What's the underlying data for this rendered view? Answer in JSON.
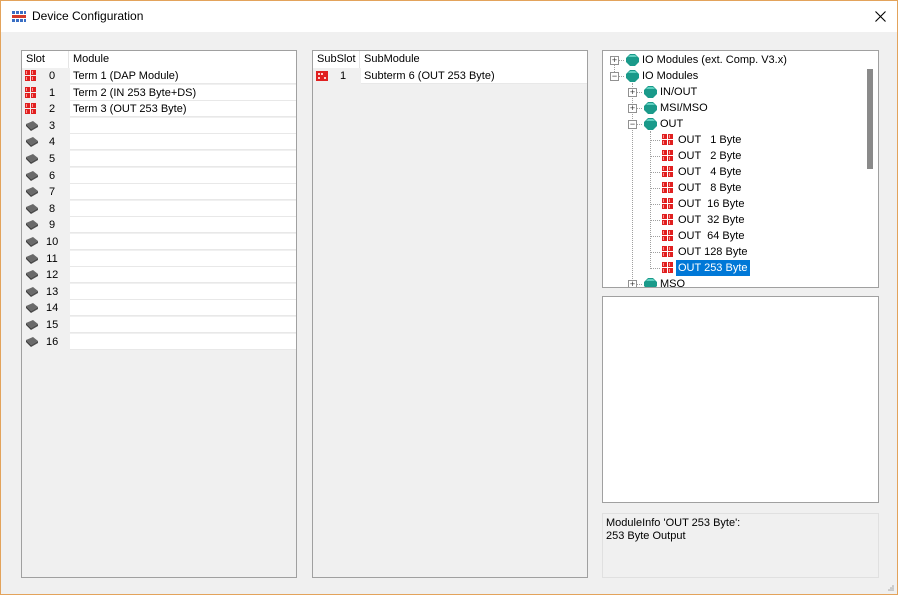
{
  "window": {
    "title": "Device Configuration"
  },
  "slots": {
    "headers": {
      "slot": "Slot",
      "module": "Module"
    },
    "rows": [
      {
        "slot": "0",
        "module": "Term 1 (DAP Module)",
        "icon": "module-red-icon"
      },
      {
        "slot": "1",
        "module": "Term 2 (IN 253 Byte+DS)",
        "icon": "module-red-icon"
      },
      {
        "slot": "2",
        "module": "Term 3 (OUT 253 Byte)",
        "icon": "module-red-icon"
      },
      {
        "slot": "3",
        "module": "",
        "icon": "empty-slot-icon"
      },
      {
        "slot": "4",
        "module": "",
        "icon": "empty-slot-icon"
      },
      {
        "slot": "5",
        "module": "",
        "icon": "empty-slot-icon"
      },
      {
        "slot": "6",
        "module": "",
        "icon": "empty-slot-icon"
      },
      {
        "slot": "7",
        "module": "",
        "icon": "empty-slot-icon"
      },
      {
        "slot": "8",
        "module": "",
        "icon": "empty-slot-icon"
      },
      {
        "slot": "9",
        "module": "",
        "icon": "empty-slot-icon"
      },
      {
        "slot": "10",
        "module": "",
        "icon": "empty-slot-icon"
      },
      {
        "slot": "11",
        "module": "",
        "icon": "empty-slot-icon"
      },
      {
        "slot": "12",
        "module": "",
        "icon": "empty-slot-icon"
      },
      {
        "slot": "13",
        "module": "",
        "icon": "empty-slot-icon"
      },
      {
        "slot": "14",
        "module": "",
        "icon": "empty-slot-icon"
      },
      {
        "slot": "15",
        "module": "",
        "icon": "empty-slot-icon"
      },
      {
        "slot": "16",
        "module": "",
        "icon": "empty-slot-icon"
      }
    ]
  },
  "subslots": {
    "headers": {
      "subslot": "SubSlot",
      "submodule": "SubModule"
    },
    "rows": [
      {
        "subslot": "1",
        "submodule": "Subterm 6 (OUT 253 Byte)",
        "icon": "submodule-red-icon"
      }
    ]
  },
  "catalog": {
    "items": [
      {
        "label": "IO Modules (ext. Comp. V3.x)",
        "expander": "+",
        "icon": "module-group-icon"
      },
      {
        "label": "IO Modules",
        "expander": "−",
        "icon": "module-group-icon"
      },
      {
        "label": "IN/OUT",
        "expander": "+",
        "icon": "module-group-icon"
      },
      {
        "label": "MSI/MSO",
        "expander": "+",
        "icon": "module-group-icon"
      },
      {
        "label": "OUT",
        "expander": "−",
        "icon": "module-group-icon"
      },
      {
        "label": "OUT   1 Byte",
        "icon": "module-red-icon"
      },
      {
        "label": "OUT   2 Byte",
        "icon": "module-red-icon"
      },
      {
        "label": "OUT   4 Byte",
        "icon": "module-red-icon"
      },
      {
        "label": "OUT   8 Byte",
        "icon": "module-red-icon"
      },
      {
        "label": "OUT  16 Byte",
        "icon": "module-red-icon"
      },
      {
        "label": "OUT  32 Byte",
        "icon": "module-red-icon"
      },
      {
        "label": "OUT  64 Byte",
        "icon": "module-red-icon"
      },
      {
        "label": "OUT 128 Byte",
        "icon": "module-red-icon"
      },
      {
        "label": "OUT 253 Byte",
        "icon": "module-red-icon",
        "selected": true
      },
      {
        "label": "MSO",
        "expander": "+",
        "icon": "module-group-icon"
      }
    ],
    "selected": "OUT 253 Byte"
  },
  "module_info": {
    "line1": "ModuleInfo 'OUT 253 Byte':",
    "line2": "253 Byte Output"
  },
  "colors": {
    "selection": "#0078d7",
    "module_red": "#e02020",
    "group_teal": "#1a9a8a",
    "border_accent": "#e3a35b"
  }
}
